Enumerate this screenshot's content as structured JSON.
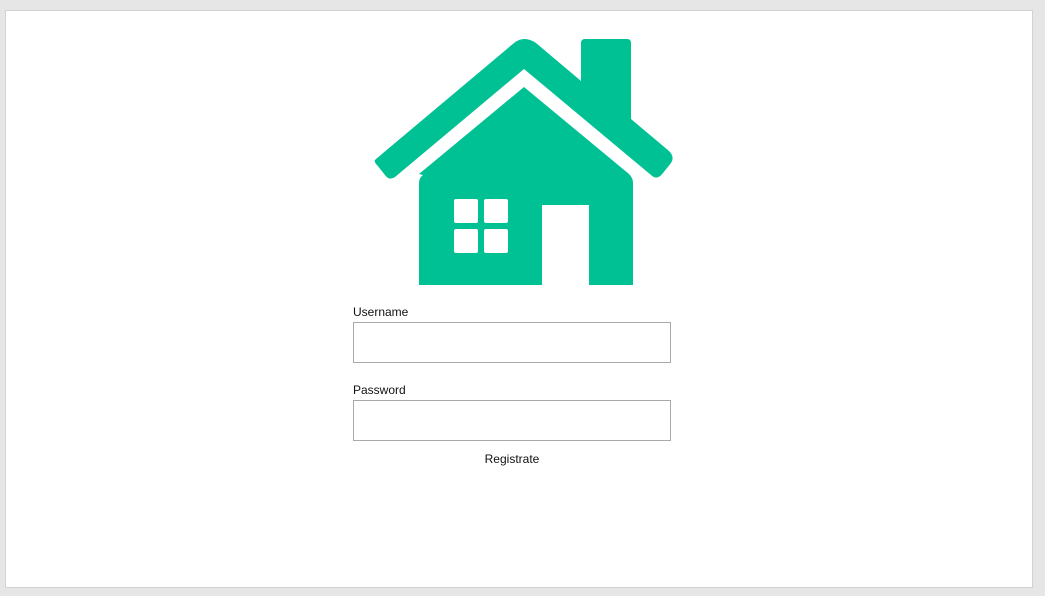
{
  "logo": {
    "icon": "house-icon",
    "color": "#00c193"
  },
  "form": {
    "username_label": "Username",
    "username_value": "",
    "password_label": "Password",
    "password_value": "",
    "register_link": "Registrate"
  }
}
